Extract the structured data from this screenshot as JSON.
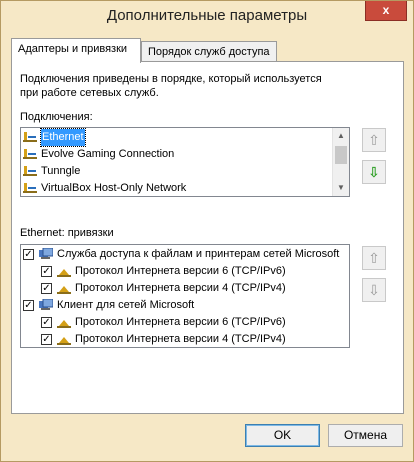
{
  "window": {
    "title": "Дополнительные параметры",
    "close_label": "x"
  },
  "tabs": [
    {
      "label": "Адаптеры и привязки",
      "active": true
    },
    {
      "label": "Порядок служб доступа",
      "active": false
    }
  ],
  "description": {
    "line1": "Подключения приведены в порядке, который используется",
    "line2": "при работе сетевых служб."
  },
  "connections": {
    "label": "Подключения:",
    "items": [
      "Ethernet",
      "Evolve Gaming Connection",
      "Tunngle",
      "VirtualBox Host-Only Network"
    ],
    "selected_index": 0
  },
  "bindings": {
    "label": "Ethernet: привязки",
    "items": [
      {
        "label": "Служба доступа к файлам и принтерам сетей Microsoft",
        "checked": true,
        "level": 0
      },
      {
        "label": "Протокол Интернета версии 6 (TCP/IPv6)",
        "checked": true,
        "level": 1
      },
      {
        "label": "Протокол Интернета версии 4 (TCP/IPv4)",
        "checked": true,
        "level": 1
      },
      {
        "label": "Клиент для сетей Microsoft",
        "checked": true,
        "level": 0
      },
      {
        "label": "Протокол Интернета версии 6 (TCP/IPv6)",
        "checked": true,
        "level": 1
      },
      {
        "label": "Протокол Интернета версии 4 (TCP/IPv4)",
        "checked": true,
        "level": 1
      }
    ]
  },
  "buttons": {
    "ok": "OK",
    "cancel": "Отмена"
  },
  "icons": {
    "up": "arrow-up-icon",
    "down": "arrow-down-icon",
    "network": "network-adapter-icon",
    "service": "service-icon",
    "protocol": "protocol-icon"
  },
  "colors": {
    "frame": "#f6e8c6",
    "selection": "#3399ff",
    "close": "#c94b3c",
    "green_arrow": "#2a9d22"
  }
}
